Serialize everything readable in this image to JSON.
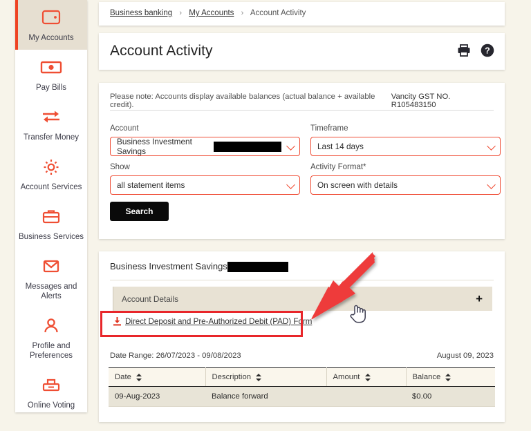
{
  "sidebar": {
    "items": [
      {
        "label": "My Accounts",
        "icon": "wallet-icon",
        "active": true
      },
      {
        "label": "Pay Bills",
        "icon": "banknote-icon",
        "active": false
      },
      {
        "label": "Transfer Money",
        "icon": "transfer-icon",
        "active": false
      },
      {
        "label": "Account Services",
        "icon": "gear-icon",
        "active": false
      },
      {
        "label": "Business Services",
        "icon": "briefcase-icon",
        "active": false
      },
      {
        "label": "Messages and Alerts",
        "icon": "envelope-icon",
        "active": false
      },
      {
        "label": "Profile and Preferences",
        "icon": "person-icon",
        "active": false
      },
      {
        "label": "Online Voting",
        "icon": "ballot-icon",
        "active": false
      }
    ]
  },
  "breadcrumb": {
    "items": [
      "Business banking",
      "My Accounts",
      "Account Activity"
    ],
    "separator": "›"
  },
  "header": {
    "title": "Account Activity",
    "print_icon": "print-icon",
    "help_icon": "help-icon"
  },
  "form": {
    "note": "Please note: Accounts display available balances (actual balance + available credit).",
    "gst": "Vancity GST NO. R105483150",
    "fields": {
      "account": {
        "label": "Account",
        "value": "Business Investment Savings",
        "redacted": true
      },
      "timeframe": {
        "label": "Timeframe",
        "value": "Last 14 days"
      },
      "show": {
        "label": "Show",
        "value": "all statement items"
      },
      "format": {
        "label": "Activity Format*",
        "value": "On screen with details"
      }
    },
    "search_label": "Search"
  },
  "results": {
    "account_name": "Business Investment Savings",
    "accordion_title": "Account Details",
    "accordion_toggle": "+",
    "pad_link": "Direct Deposit and Pre-Authorized Debit (PAD) Form",
    "pad_icon": "download-icon",
    "date_range": "Date Range: 26/07/2023 - 09/08/2023",
    "as_of_date": "August 09, 2023",
    "columns": [
      "Date",
      "Description",
      "Amount",
      "Balance"
    ],
    "rows": [
      {
        "date": "09-Aug-2023",
        "description": "Balance forward",
        "amount": "",
        "balance": "$0.00"
      }
    ]
  },
  "annotations": {
    "arrow_color": "#ee3b3b",
    "highlight_box_color": "#e8262a",
    "cursor": "pointing-hand-cursor"
  },
  "colors": {
    "page_background": "#f7f4ea",
    "accent": "#ef4323",
    "panel": "#ffffff",
    "accordion_bar": "#e8e2d4",
    "table_row": "#e8e4d7"
  }
}
